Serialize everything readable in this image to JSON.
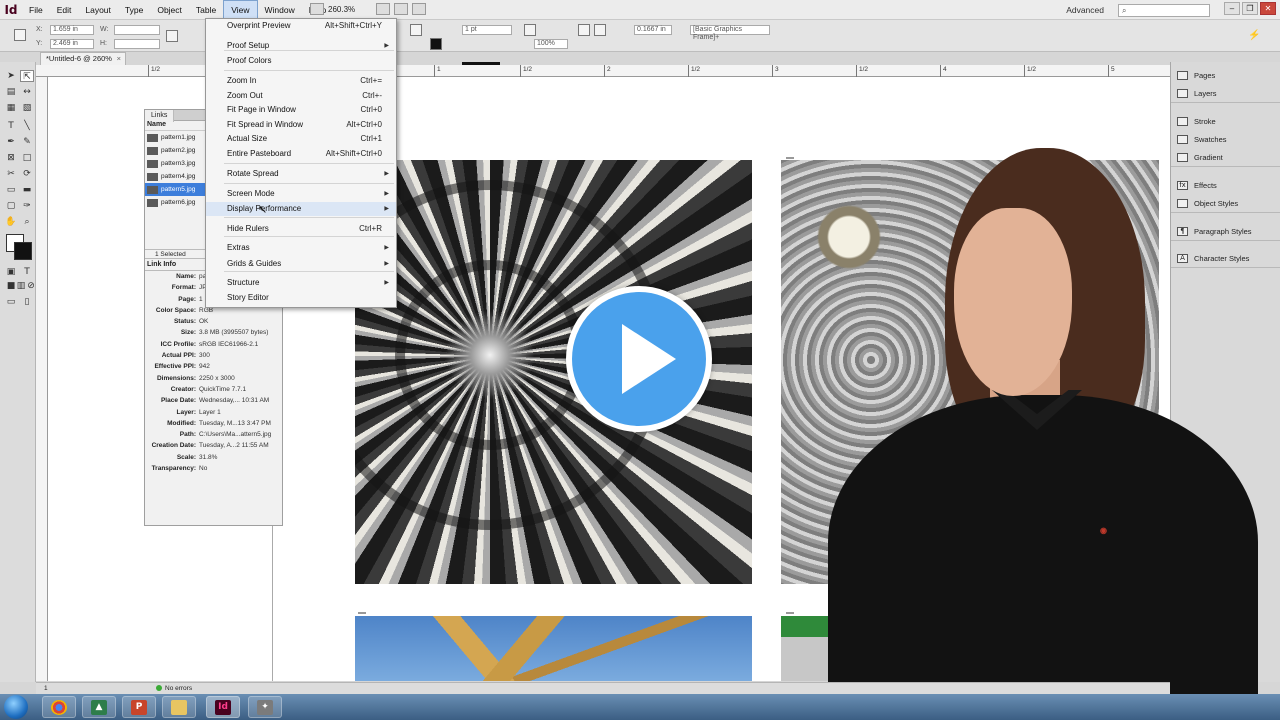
{
  "app": {
    "logo": "Id",
    "workspace": "Advanced",
    "zoom": "260.3%"
  },
  "menubar": {
    "items": [
      "File",
      "Edit",
      "Layout",
      "Type",
      "Object",
      "Table",
      "View",
      "Window",
      "Help"
    ]
  },
  "controlbar": {
    "x_label": "X:",
    "x_value": "1.659 in",
    "y_label": "Y:",
    "y_value": "2.469 in",
    "w_label": "W:",
    "h_label": "H:",
    "stroke_weight": "1 pt",
    "zoom_pct": "100%",
    "offset_value": "0.1667 in",
    "object_style": "[Basic Graphics Frame]+"
  },
  "document": {
    "tab_title": "*Untitled-6 @ 260%"
  },
  "view_menu": {
    "items": [
      {
        "label": "Overprint Preview",
        "shortcut": "Alt+Shift+Ctrl+Y",
        "submenu": false
      },
      {
        "label": "Proof Setup",
        "shortcut": "",
        "submenu": true
      },
      {
        "label": "Proof Colors",
        "shortcut": "",
        "submenu": false
      },
      {
        "label": "Zoom In",
        "shortcut": "Ctrl+=",
        "submenu": false
      },
      {
        "label": "Zoom Out",
        "shortcut": "Ctrl+-",
        "submenu": false
      },
      {
        "label": "Fit Page in Window",
        "shortcut": "Ctrl+0",
        "submenu": false
      },
      {
        "label": "Fit Spread in Window",
        "shortcut": "Alt+Ctrl+0",
        "submenu": false
      },
      {
        "label": "Actual Size",
        "shortcut": "Ctrl+1",
        "submenu": false
      },
      {
        "label": "Entire Pasteboard",
        "shortcut": "Alt+Shift+Ctrl+0",
        "submenu": false
      },
      {
        "label": "Rotate Spread",
        "shortcut": "",
        "submenu": true
      },
      {
        "label": "Screen Mode",
        "shortcut": "",
        "submenu": true
      },
      {
        "label": "Display Performance",
        "shortcut": "",
        "submenu": true
      },
      {
        "label": "Hide Rulers",
        "shortcut": "Ctrl+R",
        "submenu": false
      },
      {
        "label": "Extras",
        "shortcut": "",
        "submenu": true
      },
      {
        "label": "Grids & Guides",
        "shortcut": "",
        "submenu": true
      },
      {
        "label": "Structure",
        "shortcut": "",
        "submenu": true
      },
      {
        "label": "Story Editor",
        "shortcut": "",
        "submenu": false
      }
    ]
  },
  "links_panel": {
    "tab": "Links",
    "col_name": "Name",
    "files": [
      "pattern1.jpg",
      "pattern2.jpg",
      "pattern3.jpg",
      "pattern4.jpg",
      "pattern5.jpg",
      "pattern6.jpg"
    ],
    "selected_index": 4,
    "selected_count": "1 Selected",
    "info_title": "Link Info",
    "info": [
      {
        "k": "Name:",
        "v": "pattern5.jpg"
      },
      {
        "k": "Format:",
        "v": "JPEG"
      },
      {
        "k": "Page:",
        "v": "1"
      },
      {
        "k": "Color Space:",
        "v": "RGB"
      },
      {
        "k": "Status:",
        "v": "OK"
      },
      {
        "k": "Size:",
        "v": "3.8 MB (3995507 bytes)"
      },
      {
        "k": "ICC Profile:",
        "v": "sRGB IEC61966-2.1"
      },
      {
        "k": "Actual PPI:",
        "v": "300"
      },
      {
        "k": "Effective PPI:",
        "v": "942"
      },
      {
        "k": "Dimensions:",
        "v": "2250 x 3000"
      },
      {
        "k": "Creator:",
        "v": "QuickTime 7.7.1"
      },
      {
        "k": "Place Date:",
        "v": "Wednesday,... 10:31 AM"
      },
      {
        "k": "Layer:",
        "v": "Layer 1"
      },
      {
        "k": "Modified:",
        "v": "Tuesday, M...13 3:47 PM"
      },
      {
        "k": "Path:",
        "v": "C:\\Users\\Ma...attern5.jpg"
      },
      {
        "k": "Creation Date:",
        "v": "Tuesday, A...2 11:55 AM"
      },
      {
        "k": "Scale:",
        "v": "31.8%"
      },
      {
        "k": "Transparency:",
        "v": "No"
      }
    ]
  },
  "dock": {
    "groups": [
      [
        "Pages",
        "Layers"
      ],
      [
        "Stroke",
        "Swatches",
        "Gradient"
      ],
      [
        "Effects",
        "Object Styles"
      ],
      [
        "Paragraph Styles"
      ],
      [
        "Character Styles"
      ]
    ]
  },
  "ruler": {
    "labels": [
      "1/2",
      "1",
      "1/2",
      "2",
      "1/2",
      "3",
      "1/2",
      "4",
      "1/2",
      "5"
    ]
  },
  "status": {
    "page": "1",
    "errors": "No errors"
  },
  "colors": {
    "accent": "#4aa1ec",
    "selection": "#3d7edb",
    "indesign": "#49021f"
  }
}
